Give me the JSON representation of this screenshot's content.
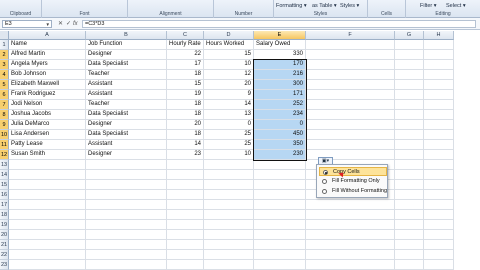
{
  "ribbon": {
    "groups": [
      "Clipboard",
      "Font",
      "Alignment",
      "Number",
      "Styles",
      "Cells",
      "Editing"
    ],
    "styles_row": [
      "Formatting ▾",
      "as Table ▾",
      "Styles ▾"
    ],
    "editing_row": [
      "Filter ▾",
      "Select ▾"
    ]
  },
  "formula_bar": {
    "name_box": "E3",
    "fx_icon": "fx",
    "formula": "=C3*D3"
  },
  "columns": [
    "A",
    "B",
    "C",
    "D",
    "E",
    "F",
    "G",
    "H"
  ],
  "selected_column": "E",
  "rows": [
    {
      "n": "1",
      "name": "Name",
      "job": "Job Function",
      "rate": "Hourly Rate",
      "hours": "Hours Worked",
      "salary": "Salary Owed"
    },
    {
      "n": "2",
      "name": "Alfred Martin",
      "job": "Designer",
      "rate": "22",
      "hours": "15",
      "salary": "330"
    },
    {
      "n": "3",
      "name": "Angela Myers",
      "job": "Data Specialist",
      "rate": "17",
      "hours": "10",
      "salary": "170"
    },
    {
      "n": "4",
      "name": "Bob Johnson",
      "job": "Teacher",
      "rate": "18",
      "hours": "12",
      "salary": "216"
    },
    {
      "n": "5",
      "name": "Elizabeth Maxwell",
      "job": "Assistant",
      "rate": "15",
      "hours": "20",
      "salary": "300"
    },
    {
      "n": "6",
      "name": "Frank Rodriguez",
      "job": "Assistant",
      "rate": "19",
      "hours": "9",
      "salary": "171"
    },
    {
      "n": "7",
      "name": "Jodi Nelson",
      "job": "Teacher",
      "rate": "18",
      "hours": "14",
      "salary": "252"
    },
    {
      "n": "8",
      "name": "Joshua Jacobs",
      "job": "Data Specialist",
      "rate": "18",
      "hours": "13",
      "salary": "234"
    },
    {
      "n": "9",
      "name": "Julia DeMarco",
      "job": "Designer",
      "rate": "20",
      "hours": "0",
      "salary": "0"
    },
    {
      "n": "10",
      "name": "Lisa Andersen",
      "job": "Data Specialist",
      "rate": "18",
      "hours": "25",
      "salary": "450"
    },
    {
      "n": "11",
      "name": "Patty Lease",
      "job": "Assistant",
      "rate": "14",
      "hours": "25",
      "salary": "350"
    },
    {
      "n": "12",
      "name": "Susan Smith",
      "job": "Designer",
      "rate": "23",
      "hours": "10",
      "salary": "230"
    },
    {
      "n": "13"
    },
    {
      "n": "14"
    },
    {
      "n": "15"
    },
    {
      "n": "16"
    },
    {
      "n": "17"
    },
    {
      "n": "18"
    },
    {
      "n": "19"
    },
    {
      "n": "20"
    },
    {
      "n": "21"
    },
    {
      "n": "22"
    },
    {
      "n": "23"
    }
  ],
  "paste_options": {
    "button_icon": "paste-options-icon",
    "items": [
      {
        "label": "Copy Cells",
        "selected": true
      },
      {
        "label": "Fill Formatting Only",
        "selected": false
      },
      {
        "label": "Fill Without Formatting",
        "selected": false
      }
    ]
  },
  "colors": {
    "selection_fill": "#b7d7f3",
    "header_selected": "#f7cf6e",
    "menu_highlight": "#fde39a"
  }
}
